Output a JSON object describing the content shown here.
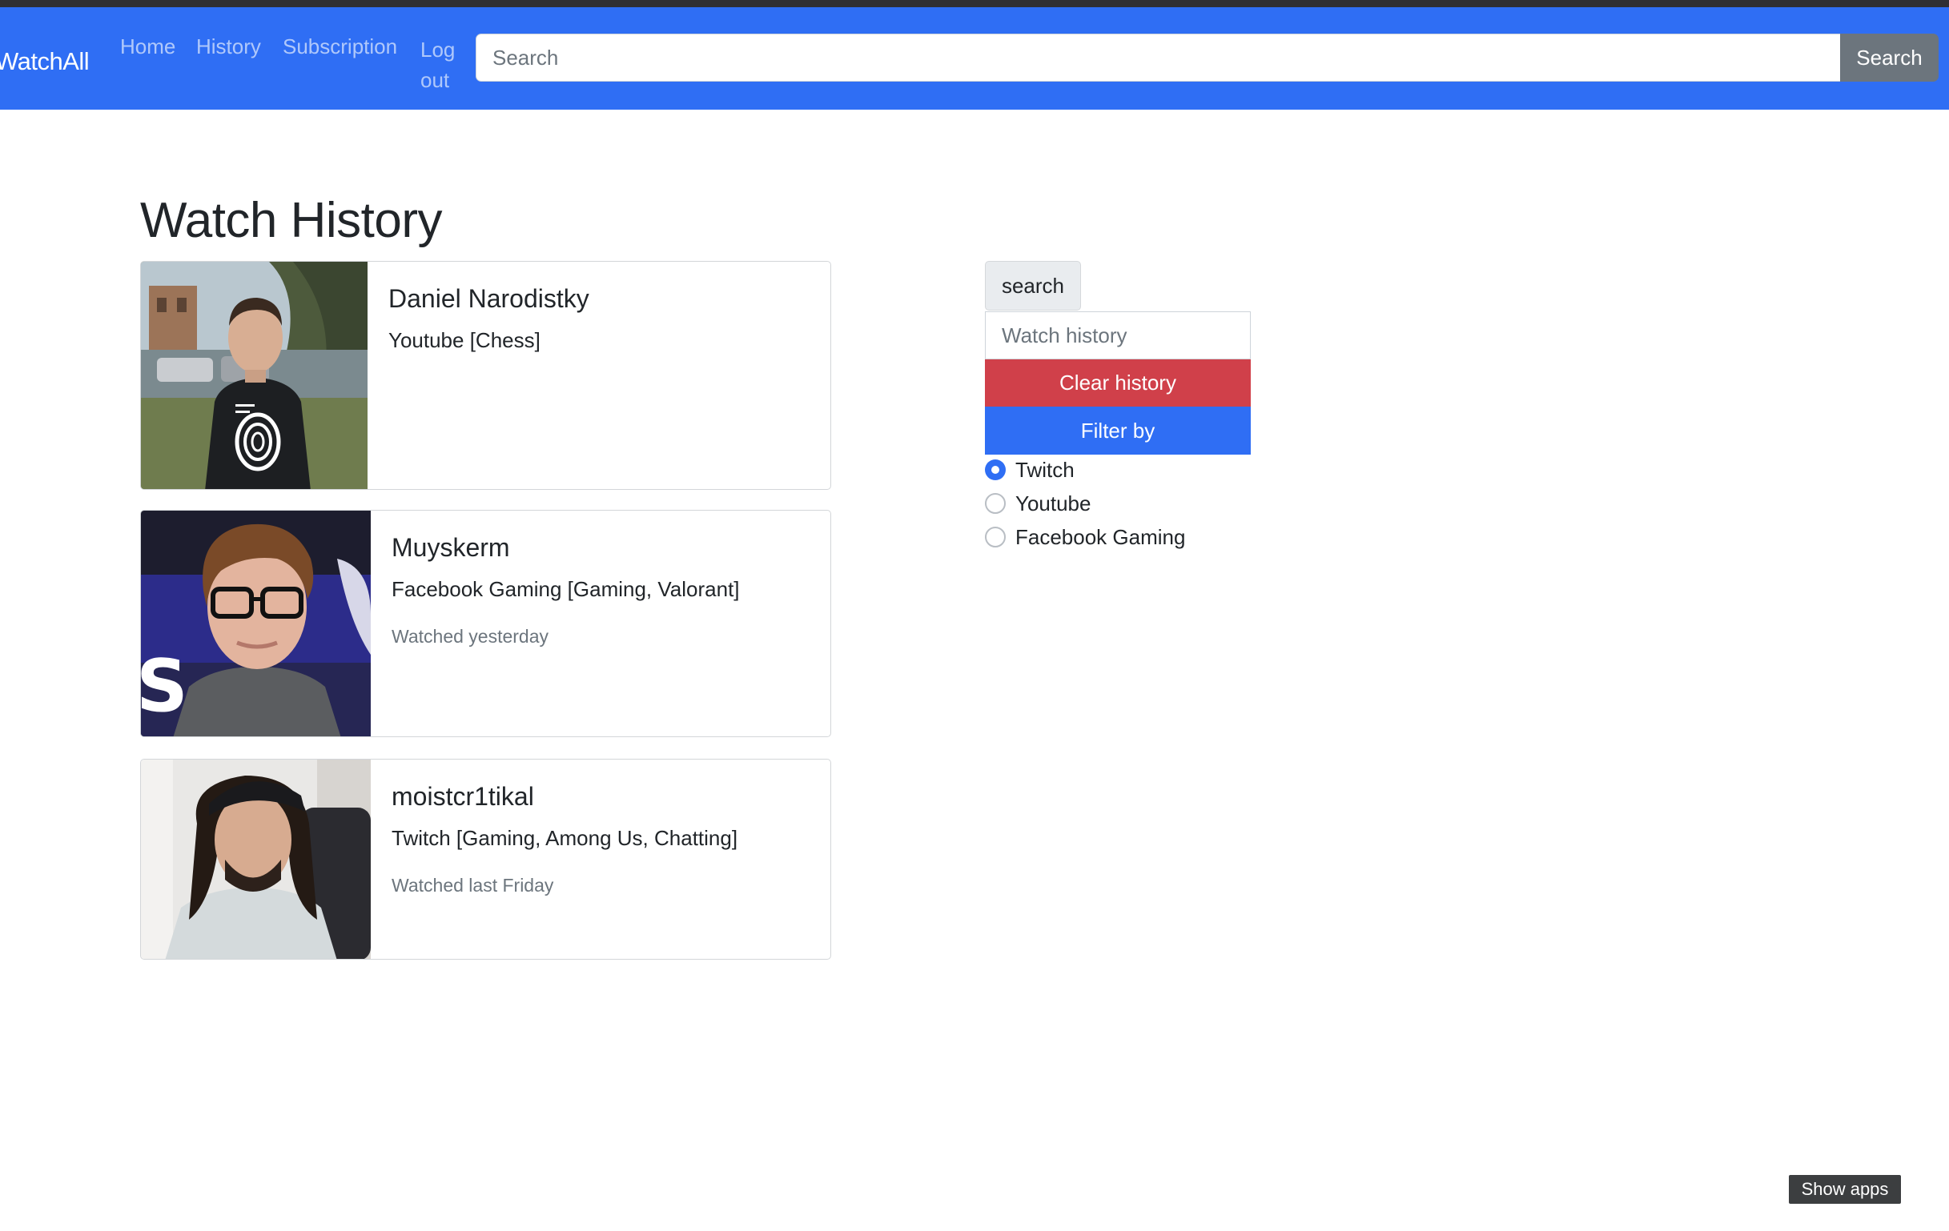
{
  "navbar": {
    "brand": "WatchAll",
    "links": [
      "Home",
      "History",
      "Subscription",
      "Log out"
    ],
    "search_placeholder": "Search",
    "search_button": "Search"
  },
  "page": {
    "title": "Watch History"
  },
  "history": [
    {
      "name": "Daniel Narodistky",
      "platform": "Youtube [Chess]",
      "watched": ""
    },
    {
      "name": "Muyskerm",
      "platform": "Facebook Gaming [Gaming, Valorant]",
      "watched": "Watched yesterday"
    },
    {
      "name": "moistcr1tikal",
      "platform": "Twitch [Gaming, Among Us, Chatting]",
      "watched": "Watched last Friday"
    }
  ],
  "sidebar": {
    "search_button": "search",
    "input_placeholder": "Watch history",
    "clear_button": "Clear history",
    "filter_button": "Filter by",
    "filters": [
      {
        "label": "Twitch",
        "checked": true
      },
      {
        "label": "Youtube",
        "checked": false
      },
      {
        "label": "Facebook Gaming",
        "checked": false
      }
    ]
  },
  "footer": {
    "show_apps": "Show apps"
  },
  "colors": {
    "primary": "#2f6ef4",
    "danger": "#d0404a",
    "secondary": "#6c757d"
  }
}
